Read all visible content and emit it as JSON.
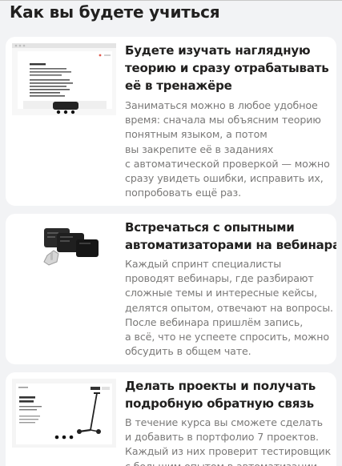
{
  "page": {
    "heading": "Как вы будете учиться"
  },
  "cards": [
    {
      "title_lines": [
        "Будете изучать наглядную",
        "теорию и сразу отрабатывать",
        "её в тренажёре"
      ],
      "text_lines": [
        "Заниматься можно в любое удобное",
        "время: сначала мы объясним теорию",
        "понятным языком, а потом",
        "вы закрепите её в заданиях",
        "с автоматической проверкой — можно",
        "сразу увидеть ошибки, исправить их,",
        "попробовать ещё раз."
      ],
      "illustration": "trainer-screenshot"
    },
    {
      "title_lines": [
        "Встречаться с опытными",
        "автоматизаторами на вебинарах"
      ],
      "text_lines": [
        "Каждый спринт специалисты",
        "проводят вебинары, где разбирают",
        "сложные темы и интересные кейсы,",
        "делятся опытом, отвечают на вопросы.",
        "После вебинара пришлём запись,",
        "а всё, что не успеете спросить, можно",
        "обсудить в общем чате."
      ],
      "illustration": "terminal-windows-with-hand-cursor"
    },
    {
      "title_lines": [
        "Делать проекты и получать",
        "подробную обратную связь"
      ],
      "text_lines": [
        "В течение курса вы сможете сделать",
        "и добавить в портфолио 7 проектов.",
        "Каждый из них проверит тестировщик",
        "с большим опытом в автоматизации"
      ],
      "illustration": "product-page-with-scooter"
    }
  ],
  "colors": {
    "background": "#f2f3f5",
    "card": "#ffffff",
    "title": "#21201f",
    "body_text": "#7a7978"
  }
}
